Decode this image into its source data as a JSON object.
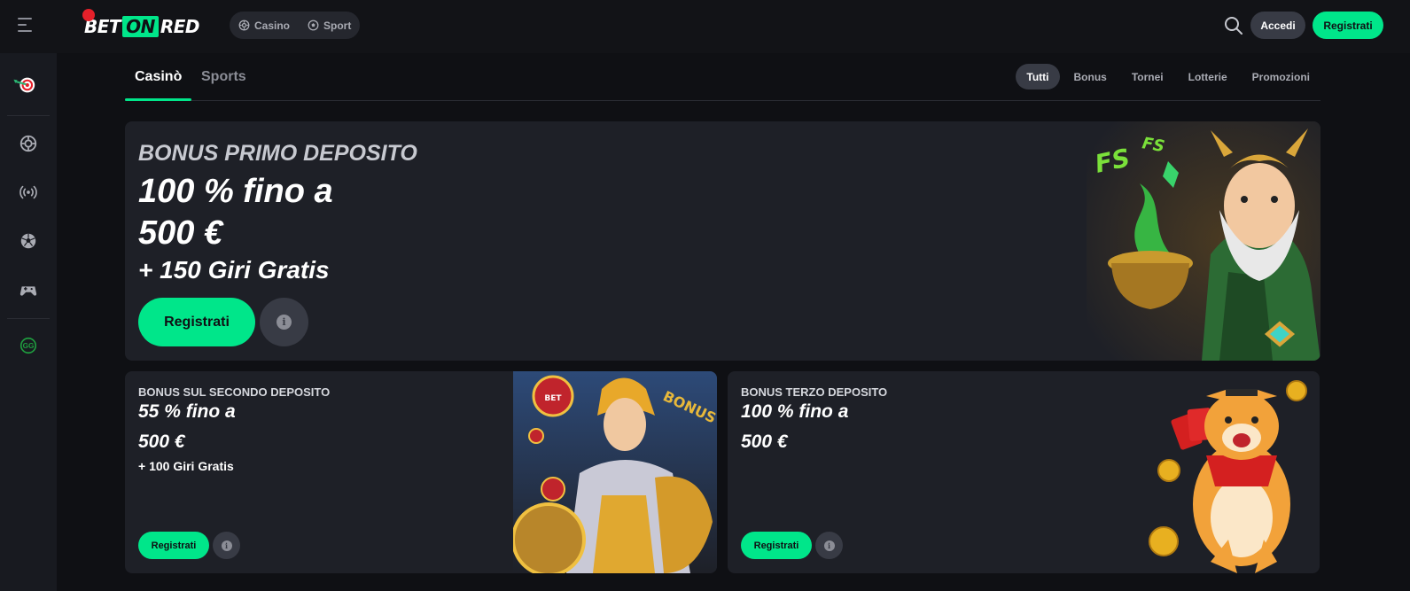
{
  "header": {
    "logo": {
      "part1": "BET",
      "part2": "ON",
      "part3": "RED"
    },
    "mode_switch": [
      {
        "label": "Casino",
        "icon": "casino-chip-icon"
      },
      {
        "label": "Sport",
        "icon": "soccer-ball-icon"
      }
    ],
    "login_label": "Accedi",
    "register_label": "Registrati"
  },
  "sidebar": {
    "items": [
      {
        "icon": "dart-target-icon"
      },
      {
        "icon": "casino-chip-icon"
      },
      {
        "icon": "live-broadcast-icon"
      },
      {
        "icon": "soccer-ball-icon"
      },
      {
        "icon": "gamepad-icon"
      },
      {
        "icon": "responsible-gaming-icon"
      }
    ]
  },
  "tabs": {
    "main": [
      {
        "label": "Casinò",
        "active": true
      },
      {
        "label": "Sports",
        "active": false
      }
    ],
    "filters": [
      {
        "label": "Tutti",
        "active": true
      },
      {
        "label": "Bonus",
        "active": false
      },
      {
        "label": "Tornei",
        "active": false
      },
      {
        "label": "Lotterie",
        "active": false
      },
      {
        "label": "Promozioni",
        "active": false
      }
    ]
  },
  "hero": {
    "kicker": "BONUS PRIMO DEPOSITO",
    "amount_line1": "100 % fino a",
    "amount_line2": "500 €",
    "extra": "+ 150 Giri Gratis",
    "register_label": "Registrati",
    "art_text": "FS"
  },
  "cards": [
    {
      "kicker": "BONUS SUL SECONDO DEPOSITO",
      "amount_line1": "55 % fino a",
      "amount_line2": "500 €",
      "extra": "+ 100 Giri Gratis",
      "register_label": "Registrati",
      "art_text": "BONUS"
    },
    {
      "kicker": "BONUS TERZO DEPOSITO",
      "amount_line1": "100 % fino a",
      "amount_line2": "500 €",
      "register_label": "Registrati"
    }
  ],
  "colors": {
    "accent": "#00e68a",
    "background": "#0f1014",
    "card": "#1e2027",
    "brand_red": "#e5202a"
  }
}
